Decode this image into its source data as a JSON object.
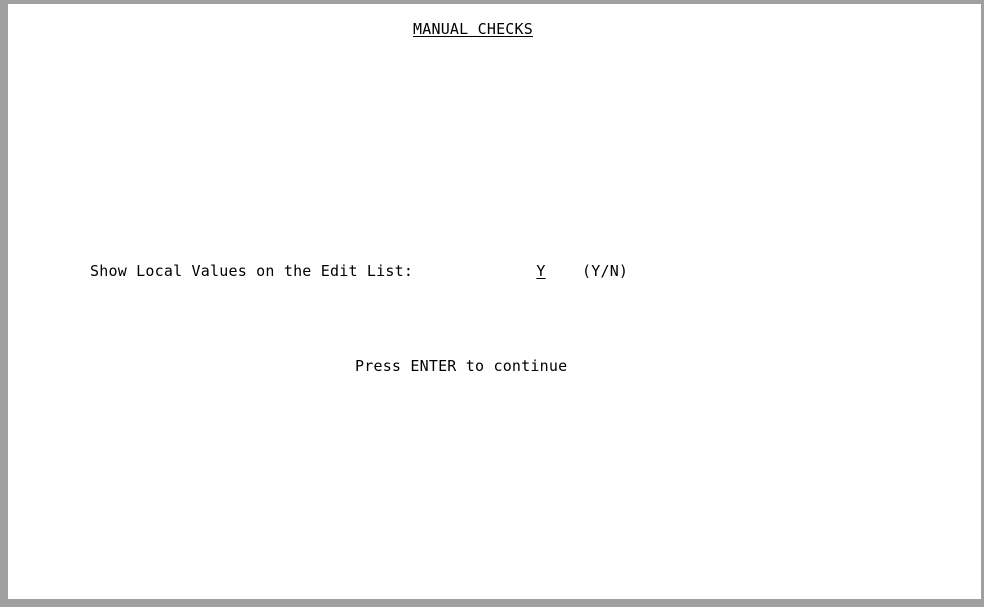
{
  "screen": {
    "title": "MANUAL CHECKS",
    "prompt_label": "Show Local Values on the Edit List:",
    "field_value": "Y",
    "field_hint": "(Y/N)",
    "instruction": "Press ENTER to continue"
  },
  "colors": {
    "background": "#ffffff",
    "text": "#000000",
    "border": "#a0a0a0"
  }
}
